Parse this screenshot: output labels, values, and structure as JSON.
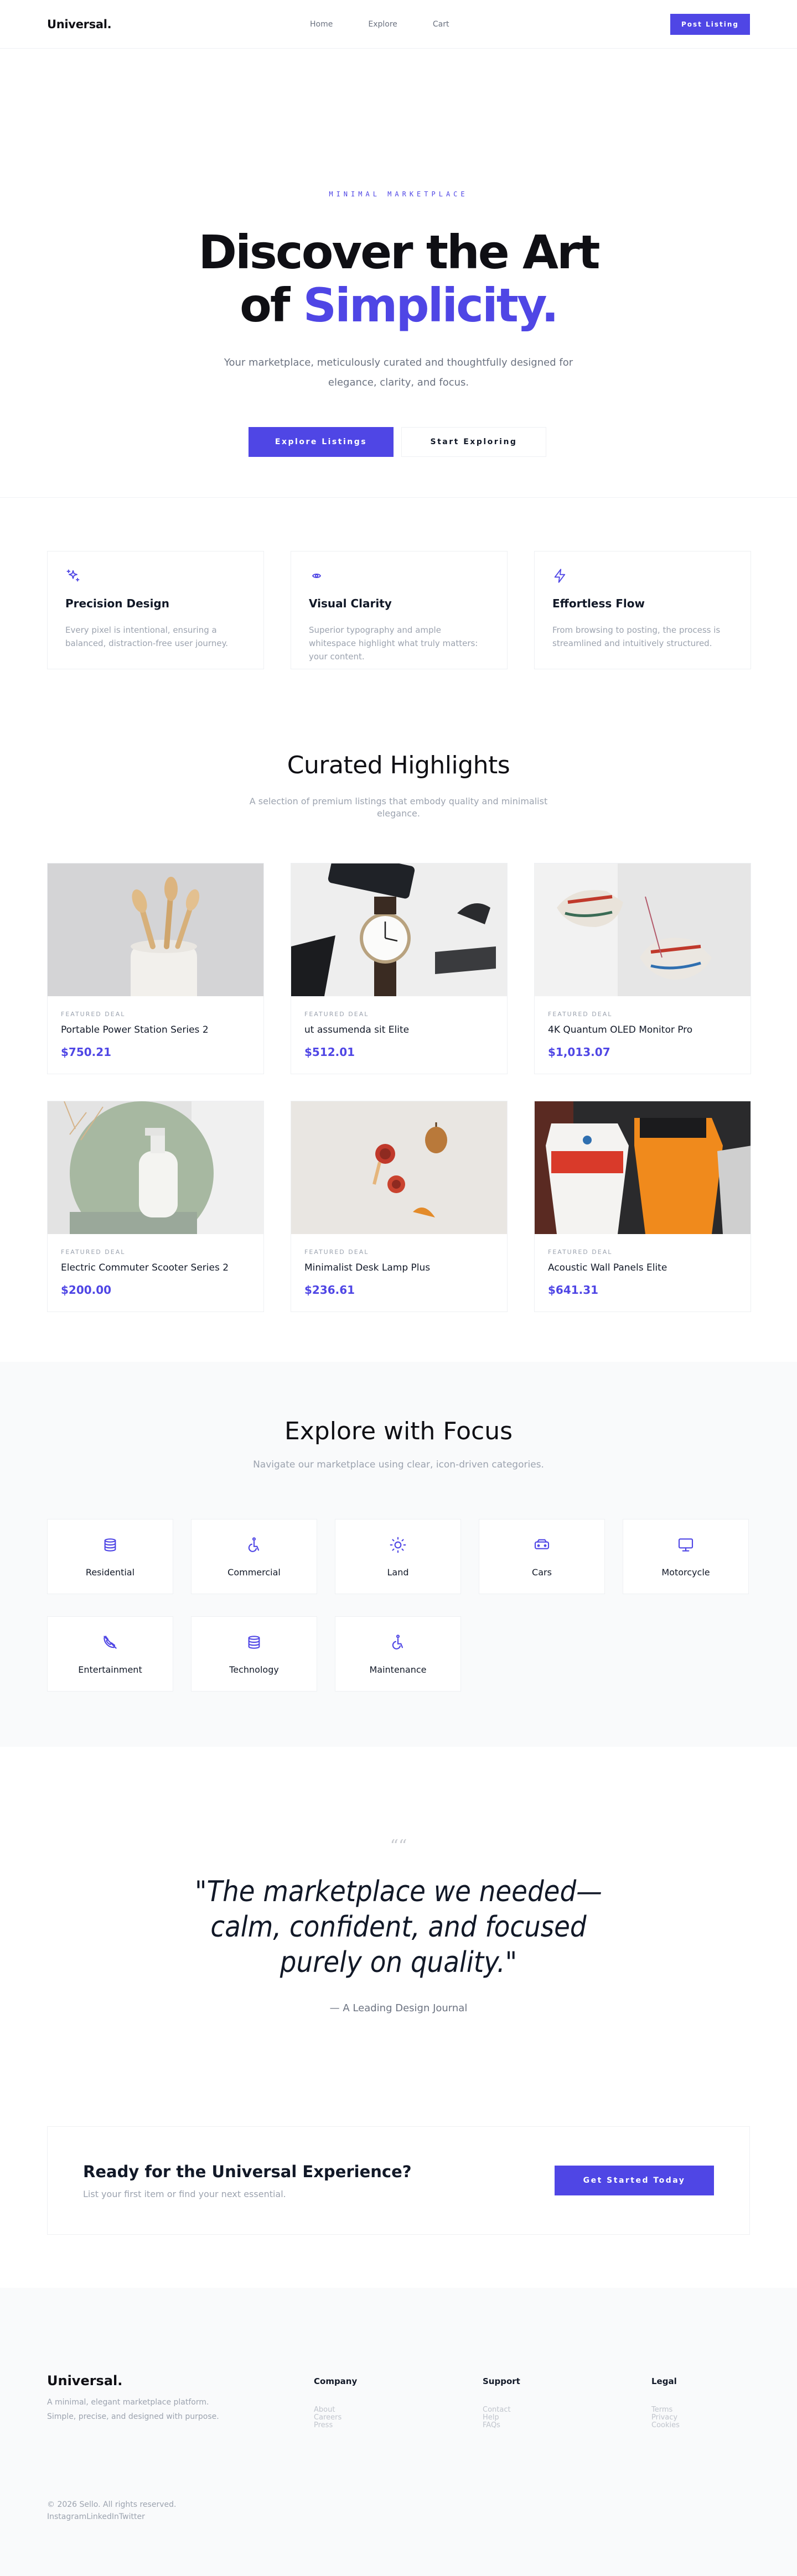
{
  "nav": {
    "logo": "Universal.",
    "links": [
      "Home",
      "Explore",
      "Cart"
    ],
    "cta": "Post Listing"
  },
  "hero": {
    "eyebrow": "MINIMAL MARKETPLACE",
    "title_line1": "Discover the Art",
    "title_of": "of",
    "title_accent": "Simplicity.",
    "subtitle": "Your marketplace, meticulously curated and thoughtfully designed for elegance, clarity, and focus.",
    "primary_cta": "Explore Listings",
    "secondary_cta": "Start Exploring"
  },
  "features": [
    {
      "icon": "sparkles-icon",
      "title": "Precision Design",
      "text": "Every pixel is intentional, ensuring a balanced, distraction-free user journey."
    },
    {
      "icon": "eye-icon",
      "title": "Visual Clarity",
      "text": "Superior typography and ample whitespace highlight what truly matters: your content."
    },
    {
      "icon": "lightning-icon",
      "title": "Effortless Flow",
      "text": "From browsing to posting, the process is streamlined and intuitively structured."
    }
  ],
  "highlights": {
    "title": "Curated Highlights",
    "subtitle": "A selection of premium listings that embody quality and minimalist elegance.",
    "listings": [
      {
        "tag": "FEATURED DEAL",
        "title": "Portable Power Station Series 2",
        "price": "$750.21"
      },
      {
        "tag": "FEATURED DEAL",
        "title": "ut assumenda sit Elite",
        "price": "$512.01"
      },
      {
        "tag": "FEATURED DEAL",
        "title": "4K Quantum OLED Monitor Pro",
        "price": "$1,013.07"
      },
      {
        "tag": "FEATURED DEAL",
        "title": "Electric Commuter Scooter Series 2",
        "price": "$200.00"
      },
      {
        "tag": "FEATURED DEAL",
        "title": "Minimalist Desk Lamp Plus",
        "price": "$236.61"
      },
      {
        "tag": "FEATURED DEAL",
        "title": "Acoustic Wall Panels Elite",
        "price": "$641.31"
      }
    ]
  },
  "categories": {
    "title": "Explore with Focus",
    "subtitle": "Navigate our marketplace using clear, icon-driven categories.",
    "items": [
      {
        "label": "Residential",
        "icon": "stack-icon"
      },
      {
        "label": "Commercial",
        "icon": "accessibility-icon"
      },
      {
        "label": "Land",
        "icon": "sun-icon"
      },
      {
        "label": "Cars",
        "icon": "car-icon"
      },
      {
        "label": "Motorcycle",
        "icon": "monitor-icon"
      },
      {
        "label": "Entertainment",
        "icon": "phone-off-icon"
      },
      {
        "label": "Technology",
        "icon": "stack-icon"
      },
      {
        "label": "Maintenance",
        "icon": "accessibility-icon"
      }
    ]
  },
  "testimonial": {
    "mark": "““",
    "quote": "\"The marketplace we needed—calm, confident, and focused purely on quality.\"",
    "source": "— A Leading Design Journal"
  },
  "cta": {
    "title": "Ready for the Universal Experience?",
    "text": "List your first item or find your next essential.",
    "button": "Get Started Today"
  },
  "footer": {
    "logo": "Universal.",
    "tagline": "A minimal, elegant marketplace platform. Simple, precise, and designed with purpose.",
    "columns": [
      {
        "title": "Company",
        "links": [
          "About",
          "Careers",
          "Press"
        ]
      },
      {
        "title": "Support",
        "links": [
          "Contact",
          "Help",
          "FAQs"
        ]
      },
      {
        "title": "Legal",
        "links": [
          "Terms",
          "Privacy",
          "Cookies"
        ]
      }
    ],
    "copyright": "© 2026 Sello. All rights reserved.",
    "social": [
      "Instagram",
      "LinkedIn",
      "Twitter"
    ]
  },
  "colors": {
    "accent": "#4f46e5",
    "muted": "#9ca3af",
    "border": "#eef0f3"
  }
}
